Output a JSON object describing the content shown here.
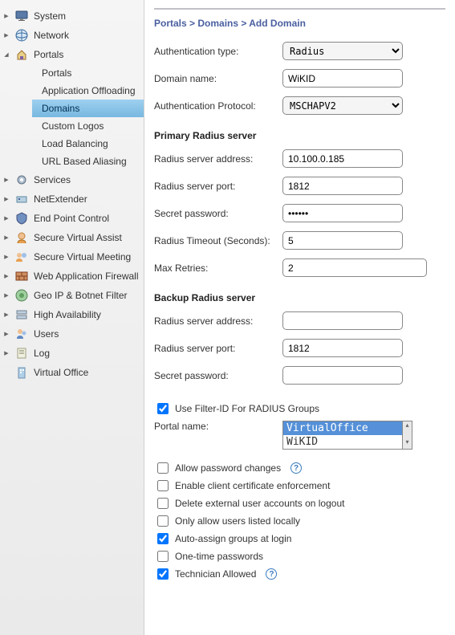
{
  "breadcrumb": "Portals > Domains > Add Domain",
  "sidebar": {
    "items": [
      {
        "label": "System"
      },
      {
        "label": "Network"
      },
      {
        "label": "Portals"
      },
      {
        "label": "Services"
      },
      {
        "label": "NetExtender"
      },
      {
        "label": "End Point Control"
      },
      {
        "label": "Secure Virtual Assist"
      },
      {
        "label": "Secure Virtual Meeting"
      },
      {
        "label": "Web Application Firewall"
      },
      {
        "label": "Geo IP & Botnet Filter"
      },
      {
        "label": "High Availability"
      },
      {
        "label": "Users"
      },
      {
        "label": "Log"
      },
      {
        "label": "Virtual Office"
      }
    ],
    "portals_sub": [
      {
        "label": "Portals"
      },
      {
        "label": "Application Offloading"
      },
      {
        "label": "Domains"
      },
      {
        "label": "Custom Logos"
      },
      {
        "label": "Load Balancing"
      },
      {
        "label": "URL Based Aliasing"
      }
    ]
  },
  "form": {
    "auth_type_label": "Authentication type:",
    "auth_type_value": "Radius",
    "domain_name_label": "Domain name:",
    "domain_name_value": "WiKID",
    "auth_proto_label": "Authentication Protocol:",
    "auth_proto_value": "MSCHAPV2",
    "primary_header": "Primary Radius server",
    "p_addr_label": "Radius server address:",
    "p_addr_value": "10.100.0.185",
    "p_port_label": "Radius server port:",
    "p_port_value": "1812",
    "p_secret_label": "Secret password:",
    "p_secret_value": "••••••",
    "timeout_label": "Radius Timeout (Seconds):",
    "timeout_value": "5",
    "retries_label": "Max Retries:",
    "retries_value": "2",
    "backup_header": "Backup Radius server",
    "b_addr_label": "Radius server address:",
    "b_addr_value": "",
    "b_port_label": "Radius server port:",
    "b_port_value": "1812",
    "b_secret_label": "Secret password:",
    "b_secret_value": "",
    "filterid_label": "Use Filter-ID For RADIUS Groups",
    "portal_label": "Portal name:",
    "portal_opt1": "VirtualOffice",
    "portal_opt2": "WiKID",
    "chk_pwchange": "Allow password changes",
    "chk_clientcert": "Enable client certificate enforcement",
    "chk_deleteext": "Delete external user accounts on logout",
    "chk_onlylisted": "Only allow users listed locally",
    "chk_autogroups": "Auto-assign groups at login",
    "chk_otp": "One-time passwords",
    "chk_tech": "Technician Allowed"
  }
}
